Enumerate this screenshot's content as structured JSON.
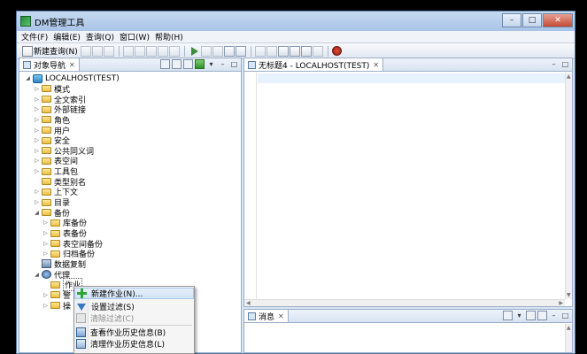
{
  "window": {
    "title": "DM管理工具",
    "controls": {
      "minimize": "–",
      "maximize": "□",
      "close": "✕"
    }
  },
  "menubar": [
    "文件(F)",
    "编辑(E)",
    "查询(Q)",
    "窗口(W)",
    "帮助(H)"
  ],
  "toolbar": {
    "new_query_label": "新建查询(N)"
  },
  "navigator": {
    "tab_label": "对象导航",
    "tab_close": "✕",
    "tree": [
      {
        "label": "LOCALHOST(TEST)",
        "level": 0,
        "icon": "database-icon",
        "expand": "expanded"
      },
      {
        "label": "模式",
        "level": 1,
        "icon": "folder-icon",
        "expand": "collapsed"
      },
      {
        "label": "全文索引",
        "level": 1,
        "icon": "folder-icon",
        "expand": "collapsed"
      },
      {
        "label": "外部链接",
        "level": 1,
        "icon": "folder-icon",
        "expand": "collapsed"
      },
      {
        "label": "角色",
        "level": 1,
        "icon": "folder-icon",
        "expand": "collapsed"
      },
      {
        "label": "用户",
        "level": 1,
        "icon": "folder-icon",
        "expand": "collapsed"
      },
      {
        "label": "安全",
        "level": 1,
        "icon": "folder-icon",
        "expand": "collapsed"
      },
      {
        "label": "公共同义词",
        "level": 1,
        "icon": "folder-icon",
        "expand": "collapsed"
      },
      {
        "label": "表空间",
        "level": 1,
        "icon": "folder-icon",
        "expand": "collapsed"
      },
      {
        "label": "工具包",
        "level": 1,
        "icon": "folder-icon",
        "expand": "collapsed"
      },
      {
        "label": "类型别名",
        "level": 1,
        "icon": "folder-icon",
        "expand": "none"
      },
      {
        "label": "上下文",
        "level": 1,
        "icon": "folder-icon",
        "expand": "collapsed"
      },
      {
        "label": "目录",
        "level": 1,
        "icon": "folder-icon",
        "expand": "collapsed"
      },
      {
        "label": "备份",
        "level": 1,
        "icon": "folder-icon",
        "expand": "expanded"
      },
      {
        "label": "库备份",
        "level": 2,
        "icon": "folder-icon",
        "expand": "collapsed"
      },
      {
        "label": "表备份",
        "level": 2,
        "icon": "folder-icon",
        "expand": "collapsed"
      },
      {
        "label": "表空间备份",
        "level": 2,
        "icon": "folder-icon",
        "expand": "collapsed"
      },
      {
        "label": "归档备份",
        "level": 2,
        "icon": "folder-icon",
        "expand": "collapsed"
      },
      {
        "label": "数据复制",
        "level": 1,
        "icon": "replication-icon",
        "expand": "none"
      },
      {
        "label": "代理",
        "level": 1,
        "icon": "agent-icon",
        "expand": "expanded"
      },
      {
        "label": "作业",
        "level": 2,
        "icon": "folder-icon",
        "expand": "none",
        "selected": true
      },
      {
        "label": "警",
        "level": 2,
        "icon": "folder-icon",
        "expand": "collapsed"
      },
      {
        "label": "操",
        "level": 2,
        "icon": "folder-icon",
        "expand": "collapsed"
      }
    ]
  },
  "editor": {
    "tab_label": "无标题4 - LOCALHOST(TEST)",
    "tab_close": "✕"
  },
  "messages": {
    "tab_label": "消息",
    "tab_close": "✕"
  },
  "context_menu": [
    {
      "label": "新建作业(N)...",
      "icon": "add-icon",
      "enabled": true,
      "hover": true
    },
    {
      "label": "设置过滤(S)",
      "icon": "filter-icon",
      "enabled": true
    },
    {
      "label": "清除过滤(C)",
      "icon": "clear-filter-icon",
      "enabled": false
    },
    {
      "label": "查看作业历史信息(B)",
      "icon": "history-icon",
      "enabled": true
    },
    {
      "label": "清理作业历史信息(L)",
      "icon": "clean-history-icon",
      "enabled": true
    }
  ]
}
